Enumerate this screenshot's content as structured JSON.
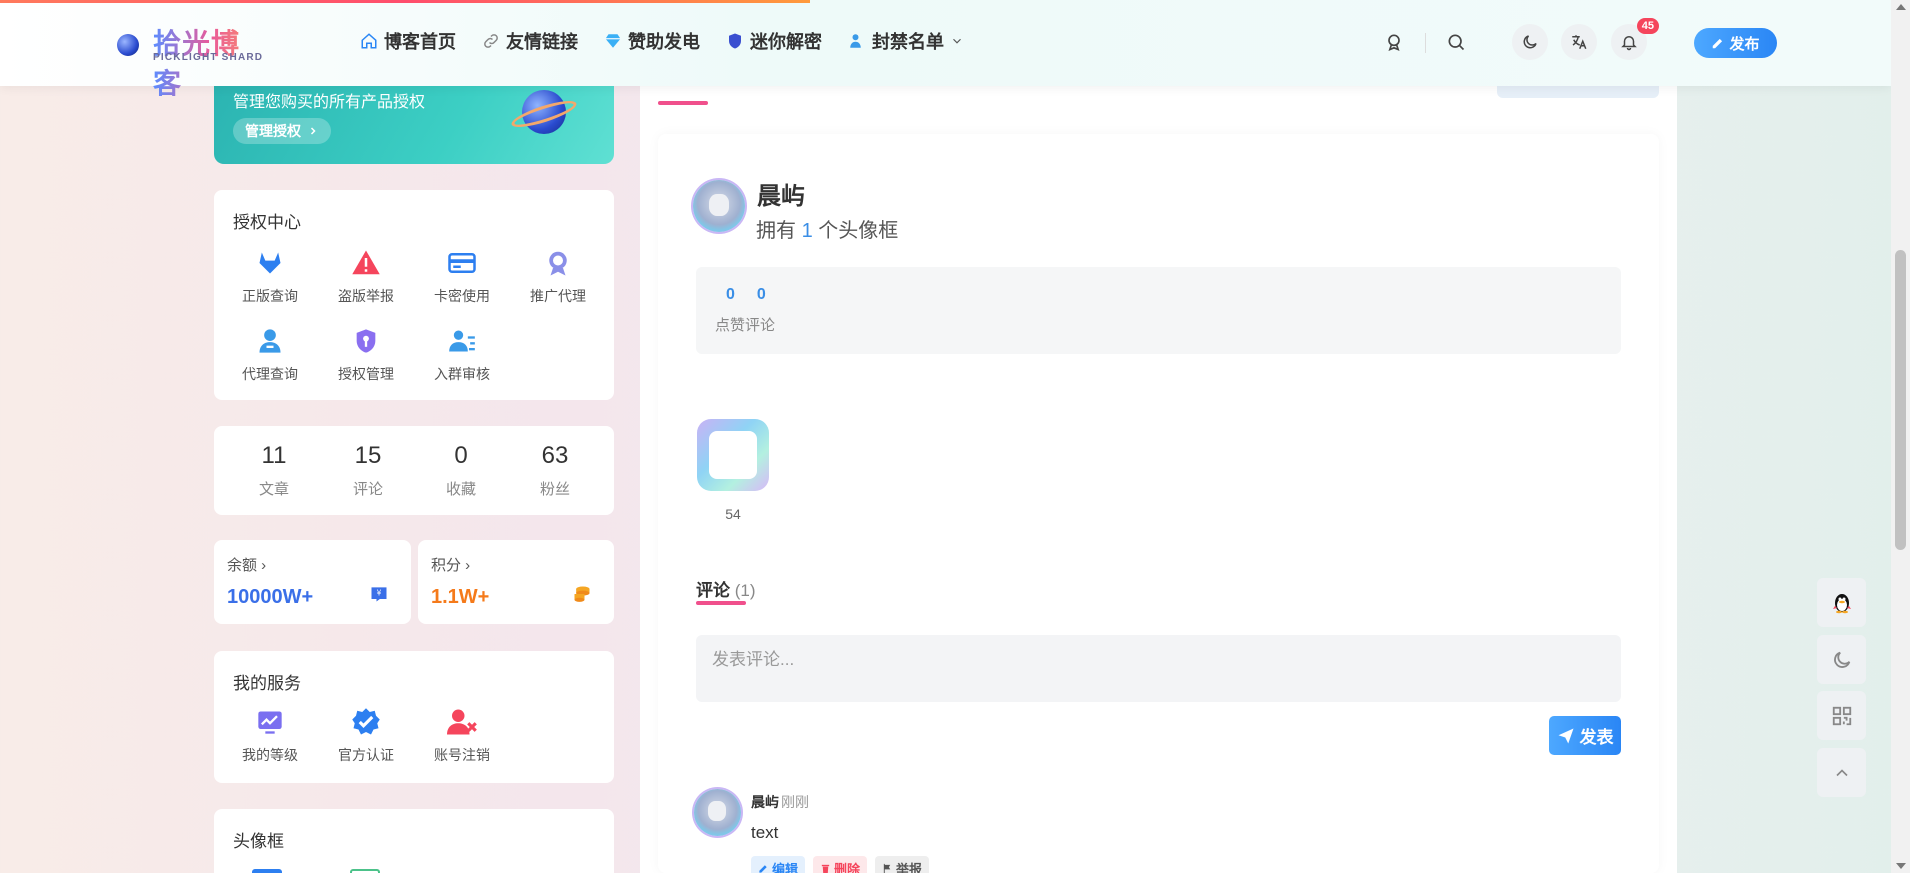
{
  "header": {
    "logo_text": "拾光博客",
    "logo_sub": "PICKLIGHT SHARD",
    "nav": [
      {
        "label": "博客首页",
        "icon": "home-icon"
      },
      {
        "label": "友情链接",
        "icon": "link-icon"
      },
      {
        "label": "赞助发电",
        "icon": "diamond-icon"
      },
      {
        "label": "迷你解密",
        "icon": "shield-icon"
      },
      {
        "label": "封禁名单",
        "icon": "user-ban-icon"
      }
    ],
    "notification_count": "45",
    "publish_label": "发布"
  },
  "sidebar": {
    "banner": {
      "text": "管理您购买的所有产品授权",
      "button": "管理授权"
    },
    "auth_center": {
      "title": "授权中心",
      "items": [
        {
          "label": "正版查询",
          "icon": "gitlab-icon",
          "color": "#2d7ff0"
        },
        {
          "label": "盗版举报",
          "icon": "warning-icon",
          "color": "#f5455c"
        },
        {
          "label": "卡密使用",
          "icon": "card-icon",
          "color": "#2d7ff0"
        },
        {
          "label": "推广代理",
          "icon": "medal-icon",
          "color": "#8a8fe8"
        },
        {
          "label": "代理查询",
          "icon": "user-icon",
          "color": "#3a9ae8"
        },
        {
          "label": "授权管理",
          "icon": "shield-user-icon",
          "color": "#8a6ff0"
        },
        {
          "label": "入群审核",
          "icon": "user-list-icon",
          "color": "#3a9ae8"
        }
      ]
    },
    "stats": [
      {
        "value": "11",
        "label": "文章"
      },
      {
        "value": "15",
        "label": "评论"
      },
      {
        "value": "0",
        "label": "收藏"
      },
      {
        "value": "63",
        "label": "粉丝"
      }
    ],
    "wallet": {
      "balance_label": "余额",
      "balance_value": "10000W+",
      "points_label": "积分",
      "points_value": "1.1W+"
    },
    "services": {
      "title": "我的服务",
      "items": [
        {
          "label": "我的等级",
          "icon": "level-icon",
          "color": "#7a6ff0"
        },
        {
          "label": "官方认证",
          "icon": "verified-icon",
          "color": "#2d7ff0"
        },
        {
          "label": "账号注销",
          "icon": "user-delete-icon",
          "color": "#f5455c"
        }
      ]
    },
    "frames_title": "头像框"
  },
  "main": {
    "user_name": "晨屿",
    "own_prefix": "拥有",
    "own_count": "1",
    "own_suffix": "个头像框",
    "likes": "0",
    "comments": "0",
    "stat_label": "点赞评论",
    "frame_number": "54",
    "comments_title": "评论",
    "comments_count": "(1)",
    "comment_placeholder": "发表评论...",
    "post_button": "发表",
    "comment": {
      "author": "晨屿",
      "time": "刚刚",
      "text": "text",
      "actions": {
        "edit": "编辑",
        "delete": "删除",
        "report": "举报"
      }
    }
  },
  "colors": {
    "accent": "#2a86f5",
    "pink": "#f0508c",
    "balance": "#3a6fe8",
    "points": "#f57a1a"
  }
}
